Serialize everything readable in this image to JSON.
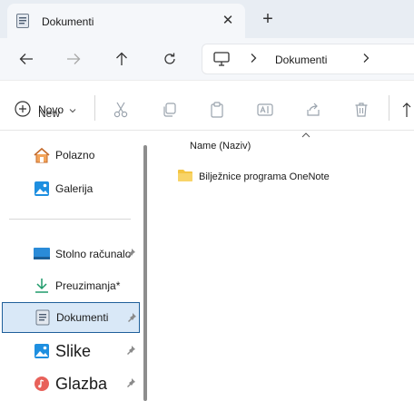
{
  "window": {
    "tab_title": "Dokumenti",
    "tab_close_glyph": "✕",
    "new_tab_glyph": "+"
  },
  "address": {
    "location": "Dokumenti"
  },
  "commands": {
    "new_label": "Novo",
    "new_label_overlay": "New"
  },
  "sidebar": {
    "items": [
      {
        "label": "Polazno",
        "icon": "home-icon"
      },
      {
        "label": "Galerija",
        "icon": "gallery-icon"
      },
      {
        "label": "Stolno računalo",
        "icon": "desktop-icon",
        "pinned": true
      },
      {
        "label": "Preuzimanja*",
        "icon": "download-icon"
      },
      {
        "label": "Dokumenti",
        "icon": "documents-icon",
        "pinned": true,
        "selected": true
      },
      {
        "label": "Slike",
        "icon": "pictures-icon",
        "pinned": true
      },
      {
        "label": "Glazba",
        "icon": "music-icon",
        "pinned": true
      }
    ]
  },
  "content": {
    "column_name": "Name (Naziv)",
    "files": [
      {
        "name": "Bilježnice programa OneNote",
        "type": "folder"
      }
    ]
  },
  "colors": {
    "accent": "#1f5f9a",
    "selected_bg": "#d9e8f7",
    "folder": "#f4c542"
  }
}
